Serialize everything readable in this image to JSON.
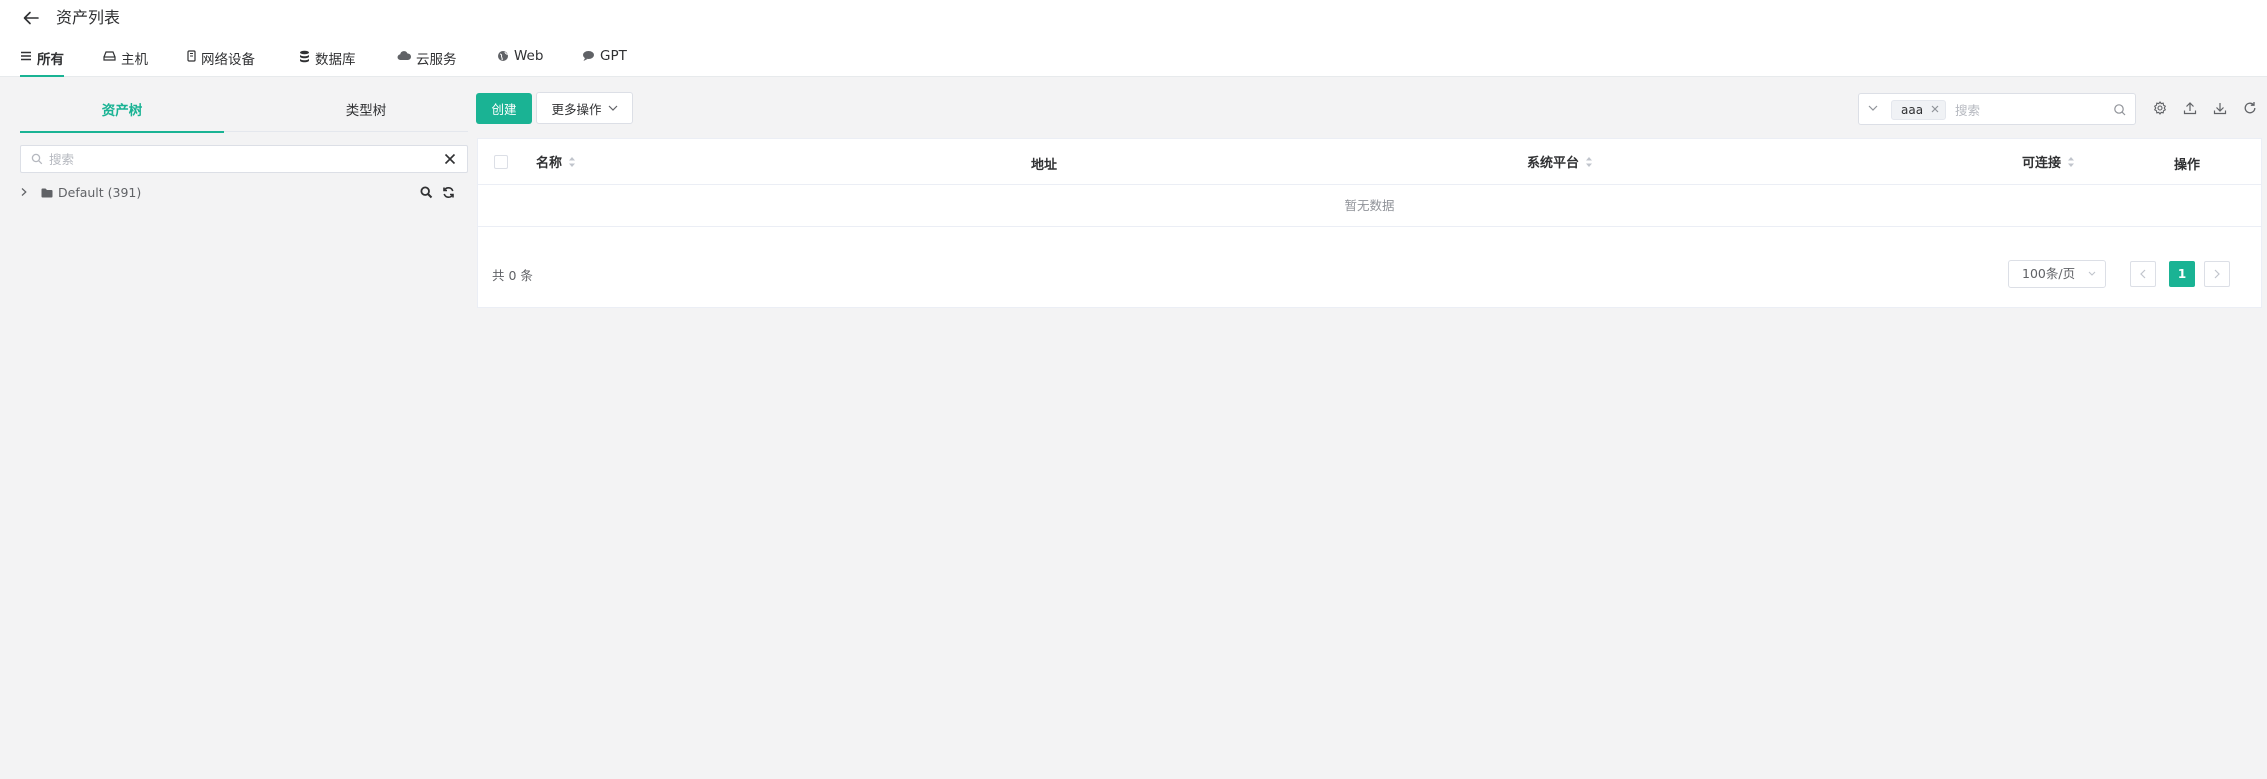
{
  "header": {
    "title": "资产列表",
    "tabs": [
      {
        "label": "所有",
        "icon": "list-icon",
        "active": true
      },
      {
        "label": "主机",
        "icon": "hdd-icon"
      },
      {
        "label": "网络设备",
        "icon": "device-icon"
      },
      {
        "label": "数据库",
        "icon": "database-icon"
      },
      {
        "label": "云服务",
        "icon": "cloud-icon"
      },
      {
        "label": "Web",
        "icon": "globe-icon"
      },
      {
        "label": "GPT",
        "icon": "comment-icon"
      }
    ]
  },
  "sidebar": {
    "tabs": [
      {
        "label": "资产树",
        "active": true
      },
      {
        "label": "类型树"
      }
    ],
    "search_placeholder": "搜索",
    "tree": [
      {
        "label": "Default (391)",
        "expanded": false
      }
    ]
  },
  "toolbar": {
    "create_label": "创建",
    "more_label": "更多操作",
    "search_tag": "aaa",
    "search_placeholder": "搜索"
  },
  "table": {
    "columns": [
      {
        "label": "名称",
        "sortable": true
      },
      {
        "label": "地址",
        "sortable": false
      },
      {
        "label": "系统平台",
        "sortable": true
      },
      {
        "label": "可连接",
        "sortable": true
      },
      {
        "label": "操作",
        "sortable": false
      }
    ],
    "rows": [],
    "empty_text": "暂无数据"
  },
  "pagination": {
    "total_text": "共 0 条",
    "page_size": "100条/页",
    "current_page": "1"
  },
  "colors": {
    "accent": "#1ab394",
    "background": "#f3f3f4"
  }
}
